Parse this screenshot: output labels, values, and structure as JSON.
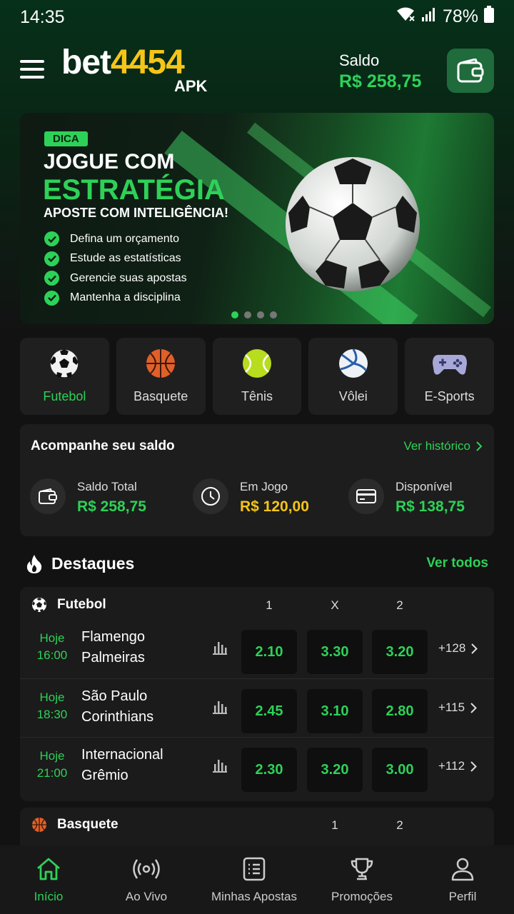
{
  "status_bar": {
    "time": "14:35",
    "battery": "78%"
  },
  "header": {
    "logo_main": "bet",
    "logo_number": "4454",
    "logo_sub": "APK",
    "balance_label": "Saldo",
    "balance_value": "R$ 258,75"
  },
  "banner": {
    "tag": "DICA",
    "title_line1": "JOGUE COM",
    "title_line2": "ESTRATÉGIA",
    "subtitle": "APOSTE COM INTELIGÊNCIA!",
    "tips": [
      "Defina um orçamento",
      "Estude as estatísticas",
      "Gerencie suas apostas",
      "Mantenha a disciplina"
    ],
    "active_slide": 1,
    "slide_count": 4
  },
  "sports": [
    {
      "label": "Futebol",
      "icon": "soccer-ball-icon",
      "active": true
    },
    {
      "label": "Basquete",
      "icon": "basketball-icon",
      "active": false
    },
    {
      "label": "Tênis",
      "icon": "tennis-ball-icon",
      "active": false
    },
    {
      "label": "Vôlei",
      "icon": "volleyball-icon",
      "active": false
    },
    {
      "label": "E-Sports",
      "icon": "gamepad-icon",
      "active": false
    }
  ],
  "balance_card": {
    "title": "Acompanhe seu saldo",
    "history_link": "Ver histórico",
    "items": [
      {
        "label": "Saldo Total",
        "value": "R$ 258,75",
        "icon": "wallet-icon",
        "color": "#2ed158"
      },
      {
        "label": "Em Jogo",
        "value": "R$ 120,00",
        "icon": "clock-icon",
        "color": "#f5c518"
      },
      {
        "label": "Disponível",
        "value": "R$ 138,75",
        "icon": "card-icon",
        "color": "#2ed158"
      }
    ]
  },
  "highlights": {
    "title": "Destaques",
    "see_all": "Ver todos",
    "football": {
      "name": "Futebol",
      "cols": [
        "1",
        "X",
        "2"
      ],
      "matches": [
        {
          "day": "Hoje",
          "time": "16:00",
          "home": "Flamengo",
          "away": "Palmeiras",
          "odds": [
            "2.10",
            "3.30",
            "3.20"
          ],
          "more": "+128"
        },
        {
          "day": "Hoje",
          "time": "18:30",
          "home": "São Paulo",
          "away": "Corinthians",
          "odds": [
            "2.45",
            "3.10",
            "2.80"
          ],
          "more": "+115"
        },
        {
          "day": "Hoje",
          "time": "21:00",
          "home": "Internacional",
          "away": "Grêmio",
          "odds": [
            "2.30",
            "3.20",
            "3.00"
          ],
          "more": "+112"
        }
      ]
    },
    "basketball": {
      "name": "Basquete",
      "cols": [
        "1",
        "2"
      ]
    }
  },
  "nav": [
    {
      "label": "Início",
      "icon": "home-icon",
      "active": true
    },
    {
      "label": "Ao Vivo",
      "icon": "live-broadcast-icon",
      "active": false
    },
    {
      "label": "Minhas Apostas",
      "icon": "bet-list-icon",
      "active": false
    },
    {
      "label": "Promoções",
      "icon": "trophy-icon",
      "active": false
    },
    {
      "label": "Perfil",
      "icon": "user-icon",
      "active": false
    }
  ],
  "colors": {
    "accent": "#2ed158",
    "gold": "#f5c518",
    "background": "#121212",
    "card": "#1d1d1d"
  }
}
